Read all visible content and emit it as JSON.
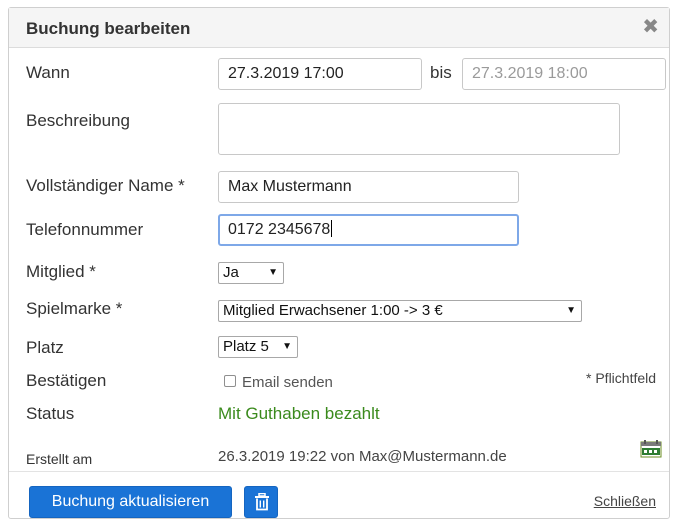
{
  "dialog": {
    "title": "Buchung bearbeiten",
    "close_glyph": "✖"
  },
  "form": {
    "wann": {
      "label": "Wann",
      "start_value": "27.3.2019  17:00",
      "separator": "bis",
      "end_value": "27.3.2019  18:00"
    },
    "beschreibung": {
      "label": "Beschreibung",
      "value": ""
    },
    "name": {
      "label": "Vollständiger Name *",
      "value": "Max Mustermann"
    },
    "telefon": {
      "label": "Telefonnummer",
      "value": "0172 2345678"
    },
    "mitglied": {
      "label": "Mitglied *",
      "selected": "Ja"
    },
    "spielmarke": {
      "label": "Spielmarke *",
      "selected": "Mitglied Erwachsener 1:00 -> 3 €"
    },
    "platz": {
      "label": "Platz",
      "selected": "Platz 5"
    },
    "bestaetigen": {
      "label": "Bestätigen",
      "checkbox_label": "Email senden",
      "checked": false
    },
    "pflichtfeld_note": "* Pflichtfeld",
    "status": {
      "label": "Status",
      "value": "Mit Guthaben bezahlt",
      "color": "#3a8a1c"
    },
    "erstellt": {
      "label": "Erstellt am",
      "value": "26.3.2019 19:22 von Max@Mustermann.de",
      "icon": "ical-icon"
    }
  },
  "footer": {
    "update_button": "Buchung aktualisieren",
    "delete_icon": "trash-icon",
    "close_link": "Schließen"
  },
  "colors": {
    "primary": "#1a73d6",
    "focus_border": "#7ea8e8",
    "status_green": "#3a8a1c"
  }
}
